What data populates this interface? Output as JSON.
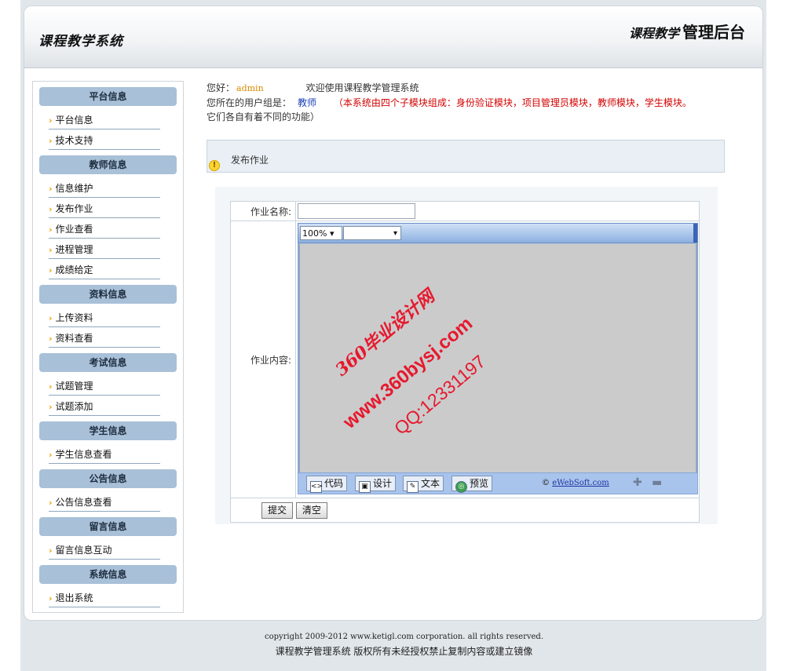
{
  "header": {
    "system_name": "课程教学系统",
    "admin_title_a": "课程教学",
    "admin_title_b": "管理后台"
  },
  "sidebar": {
    "sections": [
      {
        "title": "平台信息",
        "items": [
          "平台信息",
          "技术支持"
        ]
      },
      {
        "title": "教师信息",
        "items": [
          "信息维护",
          "发布作业",
          "作业查看",
          "进程管理",
          "成绩给定"
        ]
      },
      {
        "title": "资料信息",
        "items": [
          "上传资料",
          "资料查看"
        ]
      },
      {
        "title": "考试信息",
        "items": [
          "试题管理",
          "试题添加"
        ]
      },
      {
        "title": "学生信息",
        "items": [
          "学生信息查看"
        ]
      },
      {
        "title": "公告信息",
        "items": [
          "公告信息查看"
        ]
      },
      {
        "title": "留言信息",
        "items": [
          "留言信息互动"
        ]
      },
      {
        "title": "系统信息",
        "items": [
          "退出系统"
        ]
      }
    ]
  },
  "greeting": {
    "hello": "您好：",
    "username": "admin",
    "welcome": "欢迎使用课程教学管理系统",
    "group_label": "您所在的用户组是：",
    "group": "教师",
    "note_line1": "（本系统由四个子模块组成：身份验证模块，项目管理员模块，教师模块，学生模块。",
    "note_line2": "它们各自有着不同的功能）"
  },
  "notice": {
    "icon": "warning-icon",
    "text": "发布作业"
  },
  "form": {
    "name_label": "作业名称:",
    "name_value": "",
    "content_label": "作业内容:",
    "editor": {
      "zoom": "100%",
      "format": "",
      "modes": [
        "代码",
        "设计",
        "文本",
        "预览"
      ],
      "credit_prefix": "©",
      "credit_link": "eWebSoft.com"
    },
    "submit_label": "提交",
    "clear_label": "清空"
  },
  "watermark": {
    "line1": "360毕业设计网",
    "line2": "www.360bysj.com",
    "line3": "QQ:12331197"
  },
  "footer": {
    "copyright": "copyright 2009-2012 www.ketigl.com corporation. all rights reserved.",
    "notice": "课程教学管理系统 版权所有未经授权禁止复制内容或建立镜像"
  }
}
